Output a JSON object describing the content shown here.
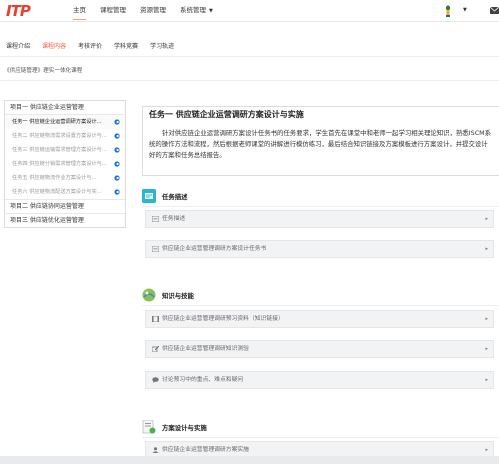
{
  "header": {
    "logo": "ITP",
    "nav": [
      {
        "label": "主页",
        "active": true
      },
      {
        "label": "课程管理",
        "active": false
      },
      {
        "label": "资源管理",
        "active": false
      },
      {
        "label": "系统管理",
        "active": false,
        "caret": "▼"
      }
    ],
    "user_caret": "▼",
    "icons": [
      "user-avatar-icon",
      "mail-icon"
    ]
  },
  "subtabs": [
    {
      "label": "课程介绍",
      "active": false
    },
    {
      "label": "课程内容",
      "active": true
    },
    {
      "label": "考核评价",
      "active": false
    },
    {
      "label": "学科竞赛",
      "active": false
    },
    {
      "label": "学习轨迹",
      "active": false
    }
  ],
  "breadcrumb": "《供应链管理》理实一体化课程",
  "sidebar": {
    "project1": "项目一 供应链企业运营管理",
    "tasks": [
      {
        "label": "任务一 供应链企业运营调研方案设计...",
        "active": true
      },
      {
        "label": "任务二 供应链物流需求设置方案设计与...",
        "active": false
      },
      {
        "label": "任务三 供应链运输需求管理方案设计与...",
        "active": false
      },
      {
        "label": "任务四 供应链分销需求管理方案设计与...",
        "active": false
      },
      {
        "label": "任务五 供应链物流作业方案设计与...",
        "active": false
      },
      {
        "label": "任务六 供应链物流配送方案设计与实...",
        "active": false
      }
    ],
    "project2": "项目二 供应链协同运营管理",
    "project3": "项目三 供应链优化运营管理"
  },
  "main": {
    "title": "任务一 供应链企业运营调研方案设计与实施",
    "intro": "针对供应链企业运营调研方案设计任务书的任务要求，学生首先在课堂中和老师一起学习相关理论知识，熟悉ISCM系统的操作方法和流程，然后根据老师课堂的讲解进行模仿练习，最后结合知识链接及方案模板进行方案设计，并提交设计好的方案和任务总结报告。",
    "sections": [
      {
        "title": "任务描述",
        "icon": "task-description-icon",
        "items": [
          {
            "label": "任务描述",
            "icon": "list-icon"
          },
          {
            "label": "供应链企业运营管理调研方案设计任务书",
            "icon": "list-icon"
          }
        ]
      },
      {
        "title": "知识与技能",
        "icon": "knowledge-skills-icon",
        "items": [
          {
            "label": "供应链企业运营管理调研预习资料（知识链接）",
            "icon": "film-icon"
          },
          {
            "label": "供应链企业运营管理调研知识测验",
            "icon": "edit-icon"
          },
          {
            "label": "讨论预习中的重点、难点和疑问",
            "icon": "comment-icon"
          }
        ]
      },
      {
        "title": "方案设计与实施",
        "icon": "design-implement-icon",
        "items": [
          {
            "label": "供应链企业运营管理调研方案实施",
            "icon": "user-icon"
          }
        ]
      }
    ],
    "arrow": "▸"
  },
  "colors": {
    "accent": "#f35a3c",
    "logo": "#e8402f",
    "toggle": "#1a73d9",
    "nav_underline": "#f7a35c"
  }
}
